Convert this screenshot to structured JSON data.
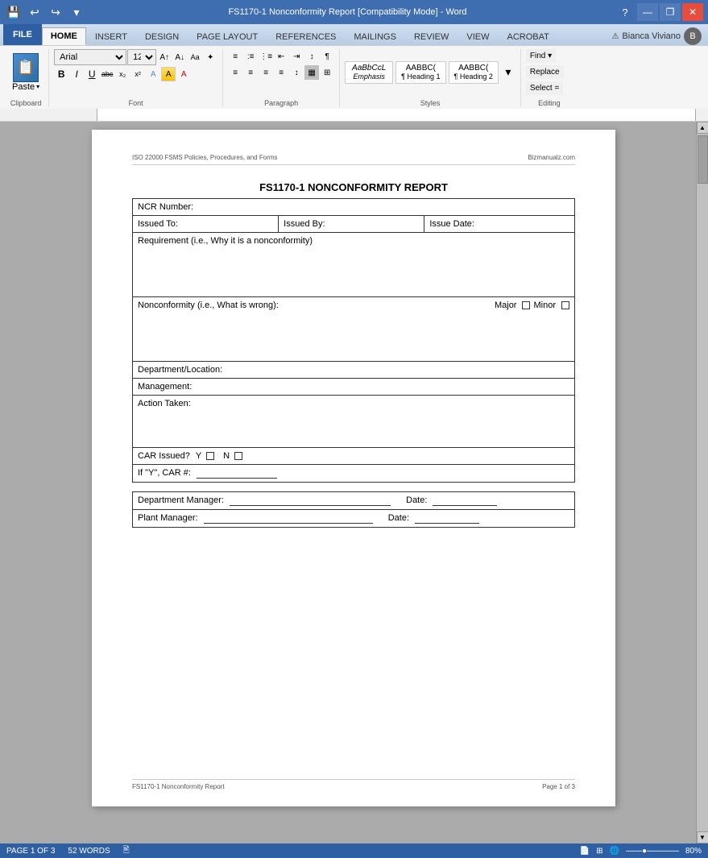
{
  "titlebar": {
    "title": "FS1170-1 Nonconformity Report [Compatibility Mode] - Word",
    "help": "?",
    "minimize": "—",
    "maximize": "❐",
    "close": "✕"
  },
  "quickaccess": {
    "save": "💾",
    "undo": "↩",
    "redo": "↪",
    "more": "▾"
  },
  "tabs": [
    "FILE",
    "HOME",
    "INSERT",
    "DESIGN",
    "PAGE LAYOUT",
    "REFERENCES",
    "MAILINGS",
    "REVIEW",
    "VIEW",
    "ACROBAT"
  ],
  "active_tab": "HOME",
  "ribbon": {
    "clipboard": {
      "label": "Clipboard",
      "paste_label": "Paste",
      "paste_icon": "📋"
    },
    "font": {
      "label": "Font",
      "font_name": "Arial",
      "font_size": "12",
      "bold": "B",
      "italic": "I",
      "underline": "U",
      "strikethrough": "abc",
      "subscript": "x₂",
      "superscript": "x²"
    },
    "paragraph": {
      "label": "Paragraph"
    },
    "styles": {
      "label": "Styles",
      "items": [
        "Emphasis",
        "¶ Heading 1",
        "¶ Heading 2"
      ]
    },
    "editing": {
      "label": "Editing",
      "find": "Find ▾",
      "replace": "Replace",
      "select": "Select ="
    }
  },
  "page": {
    "header_left": "ISO 22000 FSMS Policies, Procedures, and Forms",
    "header_right": "Bizmanualz.com",
    "title": "FS1170-1 NONCONFORMITY REPORT",
    "table": {
      "ncr_label": "NCR Number:",
      "issued_to_label": "Issued To:",
      "issued_by_label": "Issued By:",
      "issue_date_label": "Issue Date:",
      "requirement_label": "Requirement (i.e., Why it is a nonconformity)",
      "nonconformity_label": "Nonconformity (i.e., What is wrong):",
      "major_label": "Major",
      "minor_label": "Minor",
      "dept_label": "Department/Location:",
      "mgmt_label": "Management:",
      "action_label": "Action Taken:",
      "car_issued_label": "CAR Issued?",
      "car_y_label": "Y",
      "car_n_label": "N",
      "car_number_label": "If \"Y\", CAR #:",
      "dept_mgr_label": "Department Manager:",
      "plant_mgr_label": "Plant Manager:",
      "date_label": "Date:",
      "date_label2": "Date:"
    },
    "footer_left": "FS1170-1 Nonconformity Report",
    "footer_right": "Page 1 of 3"
  },
  "statusbar": {
    "page_info": "PAGE 1 OF 3",
    "word_count": "52 WORDS",
    "lang_icon": "🖹",
    "zoom": "80%",
    "zoom_level": 80
  },
  "user": {
    "name": "Bianca Viviano",
    "avatar_initial": "B"
  }
}
